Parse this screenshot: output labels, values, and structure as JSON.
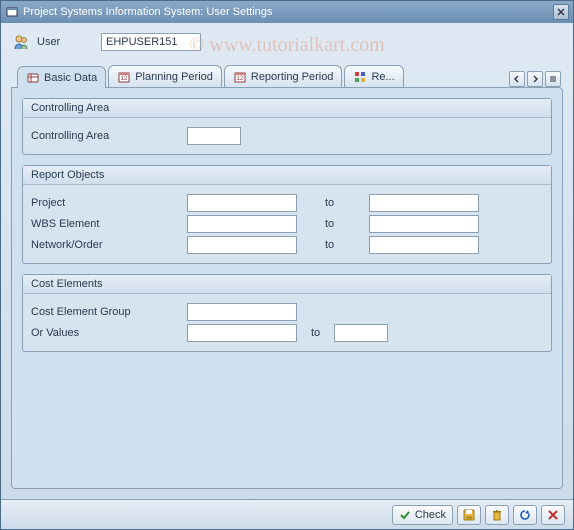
{
  "window": {
    "title": "Project Systems Information System: User Settings"
  },
  "user": {
    "label": "User",
    "value": "EHPUSER151"
  },
  "tabs": {
    "items": [
      {
        "label": "Basic Data"
      },
      {
        "label": "Planning Period"
      },
      {
        "label": "Reporting Period"
      },
      {
        "label": "Re..."
      }
    ]
  },
  "groups": {
    "controlling": {
      "title": "Controlling Area",
      "rows": {
        "controlling_area": {
          "label": "Controlling Area",
          "value": ""
        }
      }
    },
    "report_objects": {
      "title": "Report Objects",
      "to_label": "to",
      "rows": {
        "project": {
          "label": "Project",
          "from": "",
          "to": ""
        },
        "wbs": {
          "label": "WBS Element",
          "from": "",
          "to": ""
        },
        "network": {
          "label": "Network/Order",
          "from": "",
          "to": ""
        }
      }
    },
    "cost_elements": {
      "title": "Cost Elements",
      "to_label": "to",
      "rows": {
        "group": {
          "label": "Cost Element Group",
          "value": ""
        },
        "values": {
          "label": "Or Values",
          "from": "",
          "to": ""
        }
      }
    }
  },
  "footer": {
    "check_label": "Check"
  },
  "watermark": "© www.tutorialkart.com"
}
